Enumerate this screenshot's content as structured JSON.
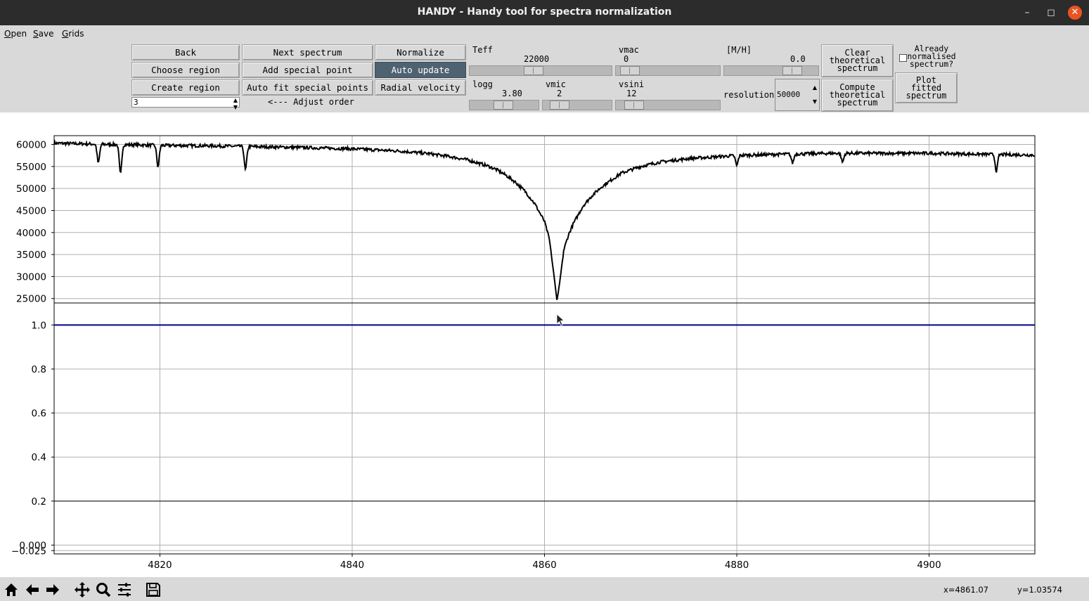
{
  "window": {
    "title": "HANDY - Handy tool for spectra normalization"
  },
  "menu": {
    "items": [
      {
        "label": "Open"
      },
      {
        "label": "Save"
      },
      {
        "label": "Grids"
      }
    ]
  },
  "toolbar": {
    "back": "Back",
    "next_spectrum": "Next spectrum",
    "normalize": "Normalize",
    "choose_region": "Choose region",
    "add_special_point": "Add special point",
    "auto_update": "Auto update",
    "create_region": "Create region",
    "auto_fit": "Auto fit special points",
    "radial_velocity": "Radial velocity",
    "order_value": "3",
    "adjust_order": "<--- Adjust order",
    "clear_theoretical": [
      "Clear",
      "theoretical",
      "spectrum"
    ],
    "compute_theoretical": [
      "Compute",
      "theoretical",
      "spectrum"
    ],
    "plot_fitted": [
      "Plot",
      "fitted",
      "spectrum"
    ],
    "already_normalised": [
      "Already",
      "normalised",
      "spectrum?"
    ],
    "resolution_label": "resolution",
    "resolution_value": "50000"
  },
  "params": {
    "teff": {
      "label": "Teff",
      "value": "22000",
      "level": 0.45
    },
    "vmac": {
      "label": "vmac",
      "value": "0",
      "level": 0.05
    },
    "mh": {
      "label": "[M/H]",
      "value": "0.0",
      "level": 0.8
    },
    "logg": {
      "label": "logg",
      "value": "3.80",
      "level": 0.5
    },
    "vmic": {
      "label": "vmic",
      "value": "2",
      "level": 0.15
    },
    "vsini": {
      "label": "vsini",
      "value": "12",
      "level": 0.1
    }
  },
  "statusbar": {
    "x_readout": "x=4861.07",
    "y_readout": "y=1.03574"
  },
  "icons": [
    "home-icon",
    "back-arrow-icon",
    "forward-arrow-icon",
    "pan-icon",
    "zoom-icon",
    "configure-icon",
    "save-icon"
  ],
  "colors": {
    "spectrum": "#000000",
    "normalized": "#00008b",
    "grid": "#b0b0b0"
  },
  "chart_data": [
    {
      "type": "line",
      "title": "",
      "xlim": [
        4809,
        4911
      ],
      "ylim": [
        24000,
        62000
      ],
      "xticks": [
        4820,
        4840,
        4860,
        4880,
        4900
      ],
      "yticks": [
        60000,
        55000,
        50000,
        45000,
        40000,
        35000,
        30000,
        25000
      ],
      "ytick_labels": [
        "60000",
        "55000",
        "50000",
        "45000",
        "40000",
        "35000",
        "30000",
        "25000"
      ],
      "grid": true,
      "series": [
        {
          "x": [
            4809,
            4815,
            4820,
            4825,
            4830,
            4835,
            4840,
            4845,
            4848,
            4850,
            4852,
            4854,
            4855,
            4856,
            4857,
            4858,
            4859,
            4860,
            4860.5,
            4861,
            4861.3,
            4861.6,
            4862,
            4862.5,
            4863,
            4864,
            4865,
            4866,
            4867,
            4868,
            4870,
            4872,
            4875,
            4880,
            4885,
            4890,
            4895,
            4900,
            4905,
            4911
          ],
          "y": [
            60300,
            60000,
            59800,
            59700,
            59500,
            59300,
            59000,
            58500,
            57900,
            57300,
            56500,
            55200,
            54300,
            53000,
            51400,
            49300,
            46500,
            42500,
            38500,
            30000,
            24500,
            29000,
            36000,
            39500,
            42000,
            46000,
            48500,
            50500,
            52000,
            53500,
            55000,
            56000,
            56800,
            57500,
            57800,
            58000,
            58000,
            58000,
            57800,
            57600
          ]
        },
        {
          "x": [
            4813.6,
            4815.9,
            4819.8,
            4828.9,
            4880,
            4885.8,
            4891,
            4907
          ],
          "y": [
            55800,
            53300,
            55000,
            54200,
            55200,
            55800,
            56000,
            54000
          ],
          "kind": "absorption-lines"
        }
      ]
    },
    {
      "type": "line",
      "title": "",
      "xlim": [
        4809,
        4911
      ],
      "ylim": [
        -0.04,
        1.1
      ],
      "xticks": [
        4820,
        4840,
        4860,
        4880,
        4900
      ],
      "yticks": [
        1.0,
        0.8,
        0.6,
        0.4,
        0.2,
        0.0,
        -0.025
      ],
      "ytick_labels": [
        "1.0",
        "0.8",
        "0.6",
        "0.4",
        "0.2",
        "0.000",
        "−0.025"
      ],
      "xtick_labels": [
        "4820",
        "4840",
        "4860",
        "4880",
        "4900"
      ],
      "grid": true,
      "series": [
        {
          "x": [
            4809,
            4911
          ],
          "y": [
            1.0,
            1.0
          ],
          "color": "#00008b"
        }
      ]
    }
  ]
}
